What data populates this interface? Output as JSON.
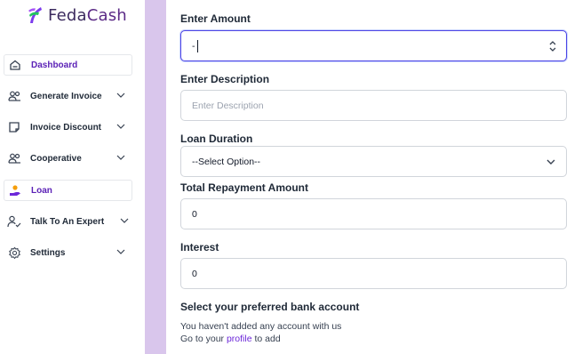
{
  "brand": {
    "name_part1": "Feda",
    "name_part2": "Cash",
    "accent": "#5b2a86"
  },
  "sidebar": {
    "items": [
      {
        "label": "Dashboard",
        "icon": "home-icon",
        "active": true
      },
      {
        "label": "Generate Invoice",
        "icon": "users-icon",
        "has_chevron": true
      },
      {
        "label": "Invoice Discount",
        "icon": "note-icon",
        "has_chevron": true
      },
      {
        "label": "Cooperative",
        "icon": "users-icon",
        "has_chevron": true
      },
      {
        "label": "Loan",
        "icon": "hand-coin-icon",
        "active": true
      },
      {
        "label": "Talk To An Expert",
        "icon": "user-check-icon",
        "has_chevron": true
      },
      {
        "label": "Settings",
        "icon": "gear-icon",
        "has_chevron": true
      }
    ]
  },
  "form": {
    "amount": {
      "label": "Enter Amount",
      "value": "-"
    },
    "description": {
      "label": "Enter Description",
      "placeholder": "Enter Description"
    },
    "duration": {
      "label": "Loan Duration",
      "selected": "--Select Option--"
    },
    "repayment": {
      "label": "Total Repayment Amount",
      "value": "0"
    },
    "interest": {
      "label": "Interest",
      "value": "0"
    }
  },
  "bank": {
    "title": "Select your preferred bank account",
    "line1": "You haven't added any account with us",
    "line2_prefix": "Go to your",
    "line2_link": "profile",
    "line2_suffix": "to add"
  },
  "colors": {
    "strip": "#d9c6ec",
    "active_text": "#5b21b6",
    "focus": "#4f46e5"
  }
}
